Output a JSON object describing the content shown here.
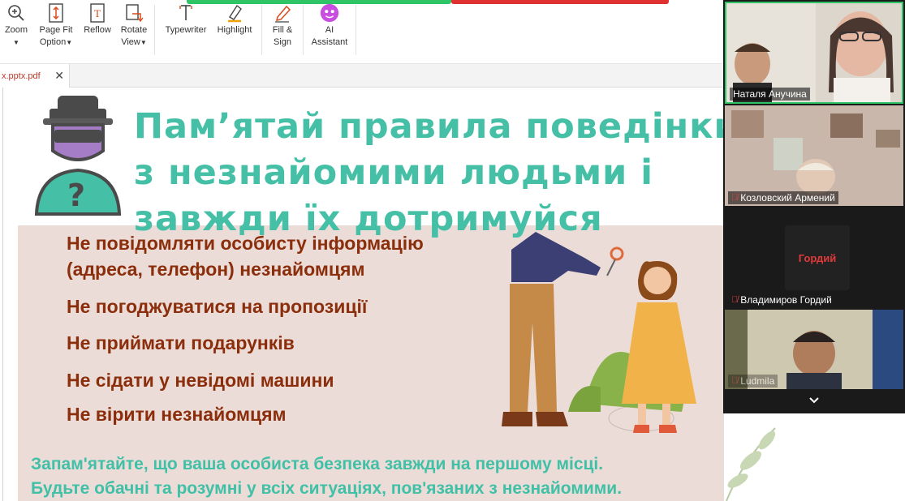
{
  "toolbar": {
    "zoom_label": "Zoom",
    "page_fit_label_1": "Page Fit",
    "page_fit_label_2": "Option",
    "reflow_label": "Reflow",
    "rotate_label_1": "Rotate",
    "rotate_label_2": "View",
    "typewriter_label": "Typewriter",
    "highlight_label": "Highlight",
    "fill_sign_label_1": "Fill &",
    "fill_sign_label_2": "Sign",
    "ai_label_1": "AI",
    "ai_label_2": "Assistant"
  },
  "tab": {
    "file_name": "x.pptx.pdf",
    "close_glyph": "✕"
  },
  "slide": {
    "title_lines": [
      "Пам’ятай правила поведінки",
      "з незнайомими людьми і",
      "завжди їх дотримуйся"
    ],
    "rules": [
      "Не повідомляти особисту інформацію",
      "(адреса, телефон) незнайомцям",
      "Не погоджуватися на пропозиції",
      "Не приймати подарунків",
      "Не сідати у невідомі машини",
      "Не вірити незнайомцям"
    ],
    "footer_lines": [
      "Запам'ятайте, що ваша особиста безпека завжди на першому місці.",
      "Будьте обачні та розумні у всіх ситуаціях, пов'язаних з незнайомими."
    ]
  },
  "participants": {
    "items": [
      {
        "name": "Наталя Анучина",
        "muted": false
      },
      {
        "name": "Козловский Армений",
        "muted": true
      },
      {
        "name": "Владимиров Гордий",
        "muted": true,
        "avatar_text": "Гордий"
      },
      {
        "name": "Ludmila",
        "muted": true
      }
    ],
    "collapse_icon": "chevron-down-icon"
  },
  "colors": {
    "title_teal": "#45c0a6",
    "rule_brown": "#8b2e0c",
    "slide_pink": "#ecdcd8",
    "active_speaker": "#2fc465",
    "mute_red": "#e04040"
  }
}
